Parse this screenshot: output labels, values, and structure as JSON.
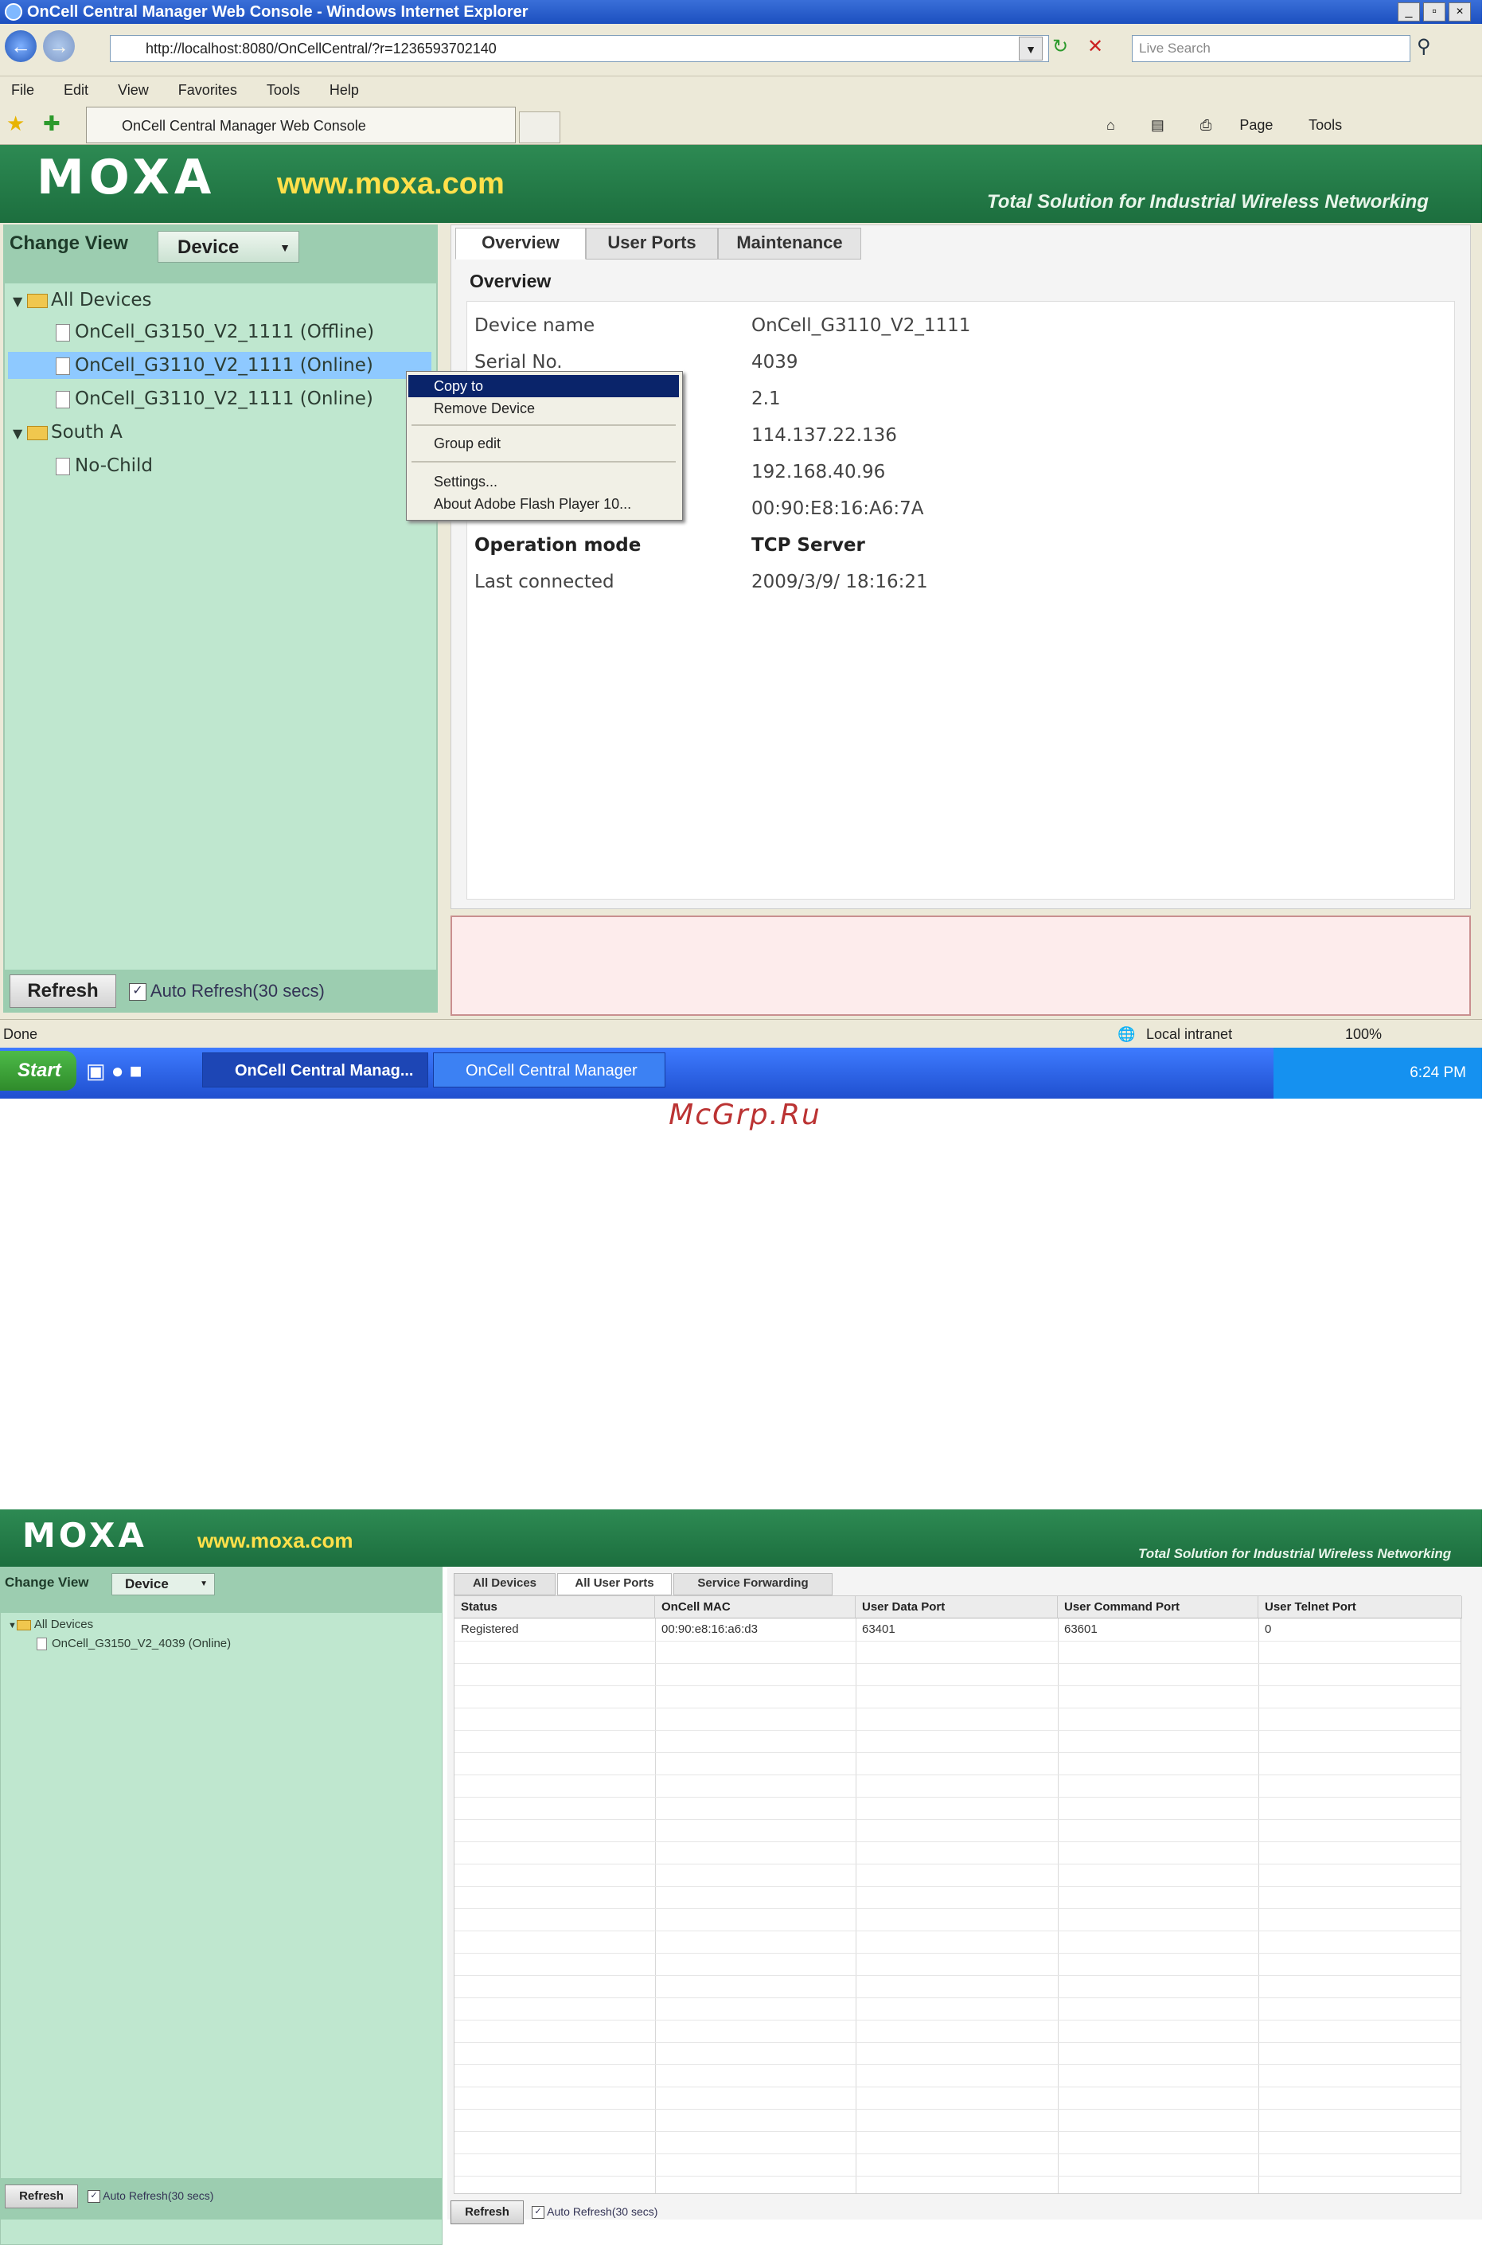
{
  "shot1": {
    "window_title": "OnCell Central Manager Web Console - Windows Internet Explorer",
    "window_buttons": [
      "_",
      "▫",
      "×"
    ],
    "address": "http://localhost:8080/OnCellCentral/?r=1236593702140",
    "search_placeholder": "Live Search",
    "menu": [
      "File",
      "Edit",
      "View",
      "Favorites",
      "Tools",
      "Help"
    ],
    "tab_title": "OnCell Central Manager Web Console",
    "commands": [
      "Page",
      "Tools"
    ],
    "brand": {
      "logo": "MOXA",
      "url": "www.moxa.com",
      "slogan": "Total Solution for Industrial Wireless Networking"
    },
    "left": {
      "change_view_label": "Change View",
      "view_select": "Device",
      "tree": [
        {
          "label": "All Devices",
          "type": "folder"
        },
        {
          "label": "OnCell_G3150_V2_1111 (Offline)",
          "type": "device"
        },
        {
          "label": "OnCell_G3110_V2_1111 (Online)",
          "type": "device"
        },
        {
          "label": "OnCell_G3110_V2_1111 (Online)",
          "type": "device"
        },
        {
          "label": "South A",
          "type": "folder"
        },
        {
          "label": "No-Child",
          "type": "device"
        }
      ],
      "refresh_label": "Refresh",
      "auto_refresh_label": "Auto Refresh(30 secs)",
      "auto_refresh_checked": true
    },
    "tabs": [
      "Overview",
      "User Ports",
      "Maintenance"
    ],
    "overview_title": "Overview",
    "overview_rows": [
      {
        "label": "Device name",
        "value": "OnCell_G3110_V2_1111"
      },
      {
        "label": "Serial No.",
        "value": "4039"
      },
      {
        "label": "",
        "value": "2.1"
      },
      {
        "label": "",
        "value": "114.137.22.136"
      },
      {
        "label": "",
        "value": "192.168.40.96"
      },
      {
        "label": "",
        "value": "00:90:E8:16:A6:7A"
      },
      {
        "label": "Operation mode",
        "value": "TCP Server"
      },
      {
        "label": "Last connected",
        "value": "2009/3/9/ 18:16:21"
      }
    ],
    "context_menu": [
      "Copy to",
      "Remove Device",
      "Group edit",
      "Settings...",
      "About Adobe Flash Player 10..."
    ],
    "status": {
      "left": "Done",
      "zone": "Local intranet",
      "zoom": "100%"
    },
    "taskbar": {
      "start": "Start",
      "items": [
        "OnCell Central Manag...",
        "OnCell Central Manager"
      ],
      "clock": "6:24 PM"
    }
  },
  "watermark": "McGrp.Ru",
  "shot2": {
    "brand": {
      "logo": "MOXA",
      "url": "www.moxa.com",
      "slogan": "Total Solution for Industrial Wireless Networking"
    },
    "change_view_label": "Change View",
    "view_select": "Device",
    "tree": [
      "All Devices",
      "OnCell_G3150_V2_4039 (Online)"
    ],
    "tabs": [
      "All Devices",
      "All User Ports",
      "Service Forwarding"
    ],
    "table": {
      "columns": [
        "Status",
        "OnCell MAC",
        "User Data Port",
        "User Command Port",
        "User Telnet Port"
      ],
      "rows": [
        [
          "Registered",
          "00:90:e8:16:a6:d3",
          "63401",
          "63601",
          "0"
        ]
      ]
    },
    "refresh_label": "Refresh",
    "auto_refresh_label": "Auto Refresh(30 secs)"
  }
}
